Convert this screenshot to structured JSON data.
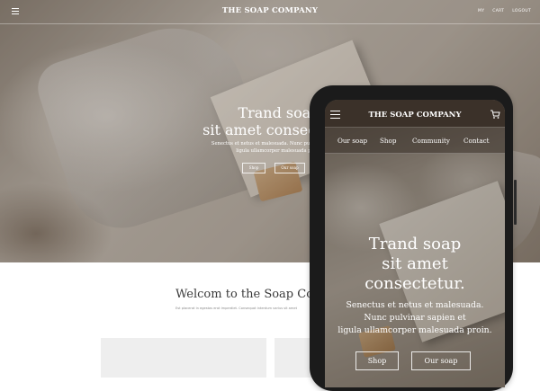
{
  "desktop": {
    "header": {
      "brand": "THE SOAP COMPANY",
      "nav": [
        "MY",
        "CART",
        "LOGOUT"
      ]
    },
    "hero": {
      "title_line1": "Trand soap",
      "title_line2": "sit amet consectetur.",
      "subtitle_line1": "Senectus et netus et malesuada. Nunc pulvinar sapien et",
      "subtitle_line2": "ligula ullamcorper malesuada proin.",
      "buttons": [
        "Shop",
        "Our soap"
      ]
    },
    "welcome": {
      "title": "Welcom to the Soap Co.T",
      "subtitle": "Est placerat in egestas erat imperdiet. Consequat interdum varius sit amet"
    }
  },
  "mobile": {
    "header": {
      "brand": "THE SOAP COMPANY"
    },
    "nav": [
      "Our soap",
      "Shop",
      "Community",
      "Contact"
    ],
    "hero": {
      "title_line1": "Trand soap",
      "title_line2": "sit amet",
      "title_line3": "consectetur.",
      "subtitle_line1": "Senectus et netus et malesuada.",
      "subtitle_line2": "Nunc pulvinar sapien et",
      "subtitle_line3": "ligula ullamcorper malesuada proin.",
      "buttons": [
        "Shop",
        "Our soap"
      ]
    }
  },
  "icons": {
    "menu": "hamburger-menu-icon",
    "cart": "shopping-cart-icon"
  },
  "colors": {
    "mobile_header": "#3b3129",
    "phone_frame": "#1b1b1b",
    "welcome_text": "#3a3a3a"
  }
}
